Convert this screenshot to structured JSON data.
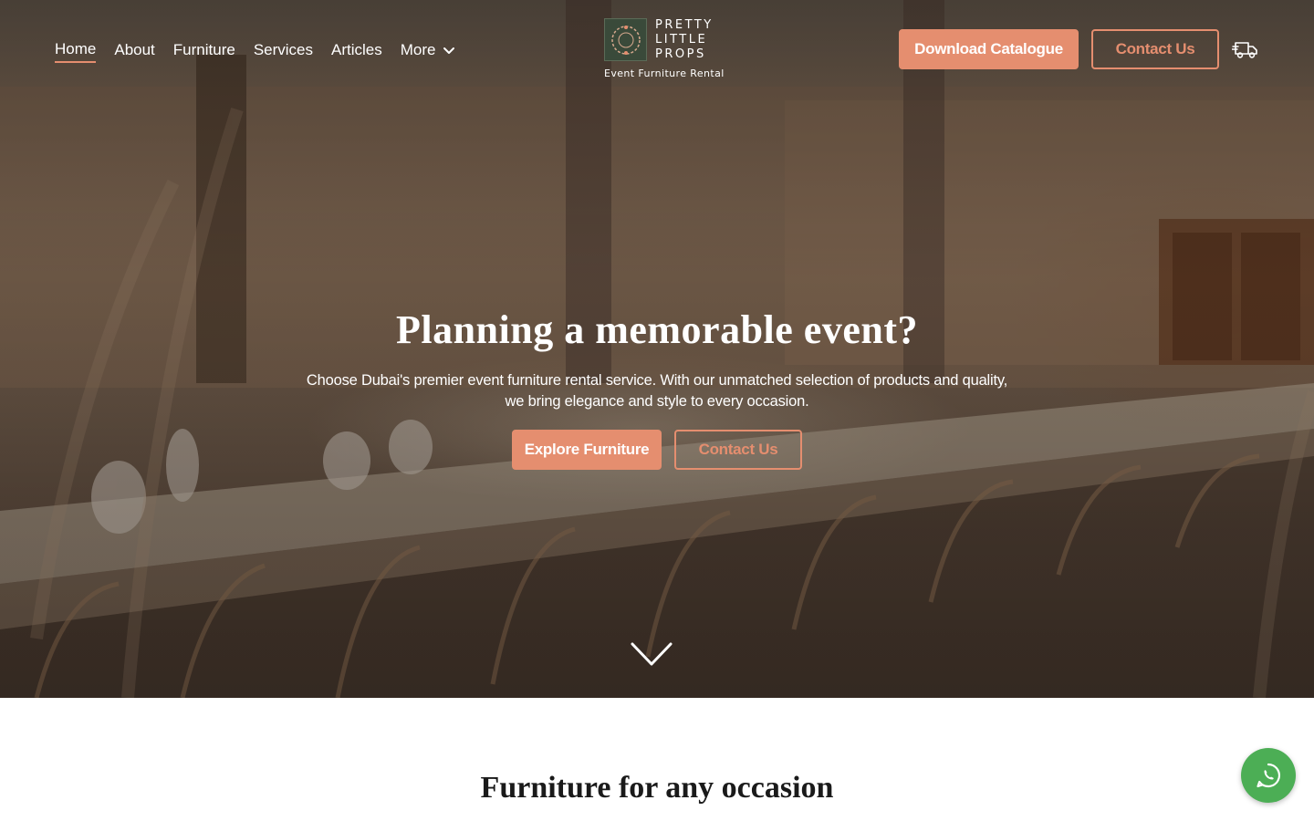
{
  "header": {
    "nav": [
      {
        "label": "Home",
        "active": true
      },
      {
        "label": "About"
      },
      {
        "label": "Furniture"
      },
      {
        "label": "Services"
      },
      {
        "label": "Articles"
      },
      {
        "label": "More",
        "has_dropdown": true
      }
    ],
    "logo": {
      "line1": "PRETTY",
      "line2": "LITTLE",
      "line3": "PROPS",
      "tagline": "Event Furniture Rental"
    },
    "download_label": "Download Catalogue",
    "contact_label": "Contact Us",
    "delivery_icon": "delivery-truck-icon"
  },
  "hero": {
    "title": "Planning a memorable event?",
    "subtitle": "Choose Dubai's premier event furniture rental service. With our unmatched selection of products and quality, we bring elegance and style to every occasion.",
    "primary_cta": "Explore Furniture",
    "secondary_cta": "Contact Us",
    "scroll_icon": "chevron-down-icon"
  },
  "section": {
    "title": "Furniture for any occasion"
  },
  "floating": {
    "whatsapp_icon": "whatsapp-icon"
  },
  "colors": {
    "accent": "#e58e6f",
    "whatsapp": "#4cae55",
    "text_dark": "#1a1a1a",
    "white": "#ffffff"
  }
}
